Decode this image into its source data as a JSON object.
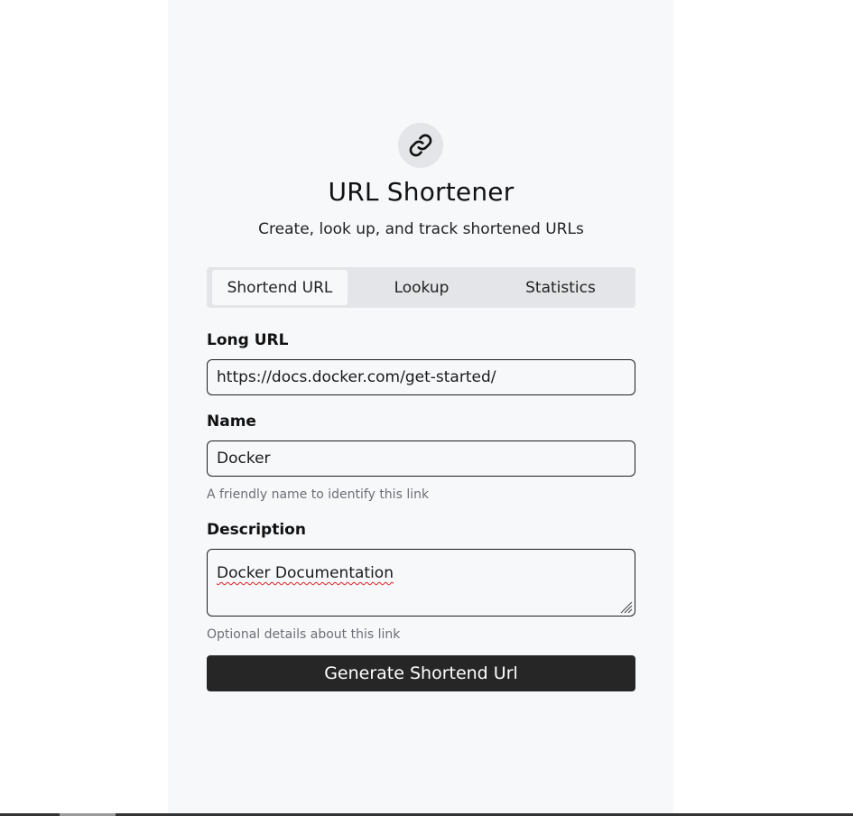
{
  "header": {
    "icon": "link-icon",
    "title": "URL Shortener",
    "subtitle": "Create, look up, and track shortened URLs"
  },
  "tabs": [
    {
      "label": "Shortend URL",
      "active": true
    },
    {
      "label": "Lookup",
      "active": false
    },
    {
      "label": "Statistics",
      "active": false
    }
  ],
  "form": {
    "long_url": {
      "label": "Long URL",
      "value": "https://docs.docker.com/get-started/"
    },
    "name": {
      "label": "Name",
      "value": "Docker",
      "hint": "A friendly name to identify this link"
    },
    "description": {
      "label": "Description",
      "value": "Docker Documentation",
      "hint": "Optional details about this link"
    },
    "submit_label": "Generate Shortend Url"
  },
  "colors": {
    "panel_bg": "#f7f8fa",
    "button_bg": "#262626",
    "tab_bar_bg": "#e4e5e8"
  }
}
